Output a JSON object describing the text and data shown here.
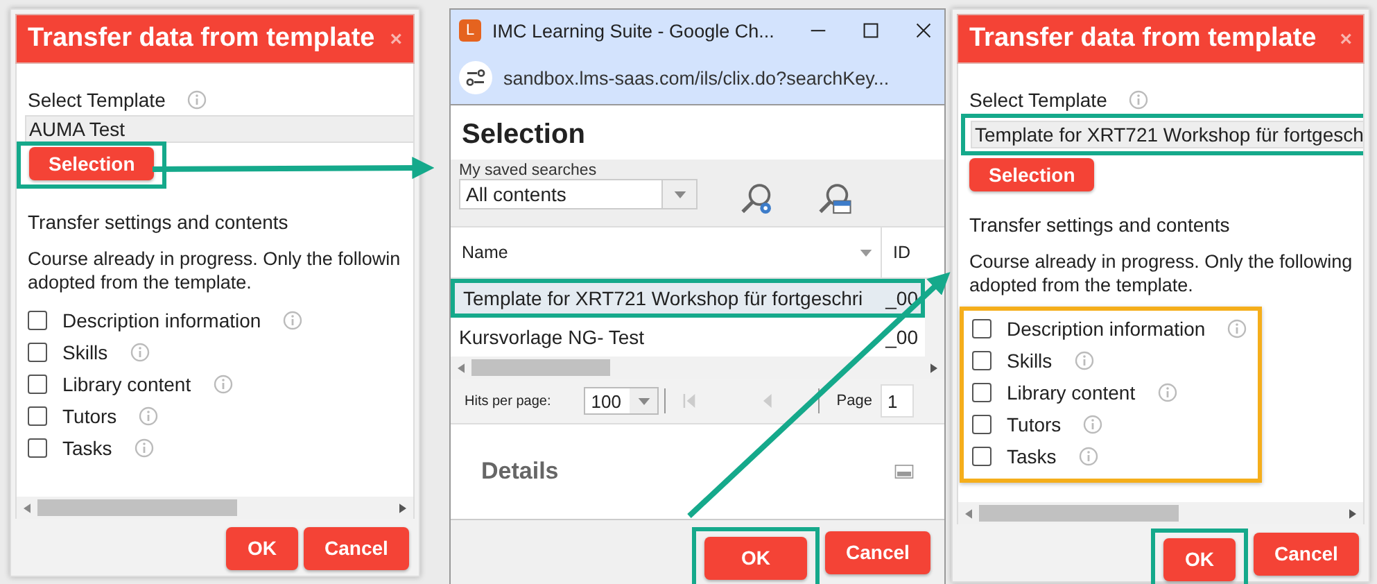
{
  "dialogs": [
    {
      "title": "Transfer data from template",
      "close": "×",
      "template_label": "Select Template",
      "template_value": "AUMA Test",
      "template_highlighted": false,
      "selection_button": "Selection",
      "selection_highlighted": true,
      "section_title": "Transfer settings and contents",
      "note_lines": [
        "Course already in progress. Only the followin",
        "adopted from the template."
      ],
      "options_highlighted": false,
      "options": [
        {
          "label": "Description information",
          "checked": false
        },
        {
          "label": "Skills",
          "checked": false
        },
        {
          "label": "Library content",
          "checked": false
        },
        {
          "label": "Tutors",
          "checked": false
        },
        {
          "label": "Tasks",
          "checked": false
        }
      ],
      "ok": "OK",
      "ok_highlighted": false,
      "cancel": "Cancel"
    },
    {
      "title": "Transfer data from template",
      "close": "×",
      "template_label": "Select Template",
      "template_value": "Template for XRT721 Workshop für fortgesch",
      "template_highlighted": true,
      "selection_button": "Selection",
      "selection_highlighted": false,
      "section_title": "Transfer settings and contents",
      "note_lines": [
        "Course already in progress. Only the following",
        "adopted from the template."
      ],
      "options_highlighted": true,
      "options": [
        {
          "label": "Description information",
          "checked": false
        },
        {
          "label": "Skills",
          "checked": false
        },
        {
          "label": "Library content",
          "checked": false
        },
        {
          "label": "Tutors",
          "checked": false
        },
        {
          "label": "Tasks",
          "checked": false
        }
      ],
      "ok": "OK",
      "ok_highlighted": true,
      "cancel": "Cancel"
    }
  ],
  "browser": {
    "app_icon": "L",
    "title": "IMC Learning Suite - Google Ch...",
    "url": "sandbox.lms-saas.com/ils/clix.do?searchKey...",
    "heading": "Selection",
    "saved_searches_label": "My saved searches",
    "saved_search": "All contents",
    "columns": [
      "Name",
      "ID"
    ],
    "rows": [
      {
        "name": "Template for XRT721 Workshop für fortgeschri",
        "id": "_00",
        "selected": true,
        "highlighted": true
      },
      {
        "name": "Kursvorlage NG- Test",
        "id": "_00",
        "selected": false,
        "highlighted": false
      }
    ],
    "hits_label": "Hits per page:",
    "hits": "100",
    "page_label": "Page",
    "page": "1",
    "details": "Details",
    "ok": "OK",
    "ok_highlighted": true,
    "cancel": "Cancel"
  }
}
